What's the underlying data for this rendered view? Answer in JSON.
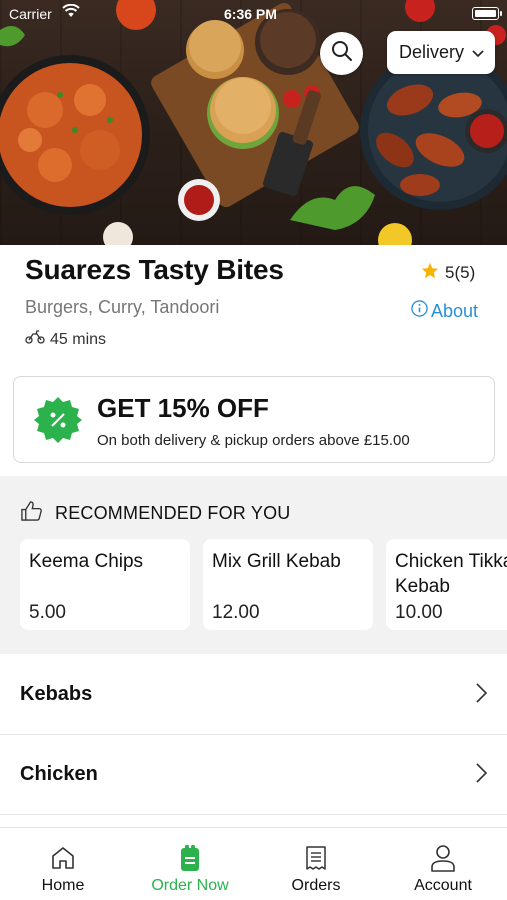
{
  "status_bar": {
    "carrier": "Carrier",
    "time": "6:36 PM"
  },
  "header": {
    "delivery_mode": "Delivery"
  },
  "restaurant": {
    "name": "Suarezs Tasty Bites",
    "rating": "5(5)",
    "cuisines": "Burgers, Curry, Tandoori",
    "about_label": "About",
    "delivery_time": "45 mins"
  },
  "offer": {
    "title": "GET 15% OFF",
    "subtitle": "On both delivery & pickup orders above £15.00"
  },
  "recommended": {
    "heading": "RECOMMENDED FOR YOU",
    "items": [
      {
        "name": "Keema Chips",
        "price": "5.00"
      },
      {
        "name": "Mix Grill Kebab",
        "price": "12.00"
      },
      {
        "name": "Chicken Tikka Kebab",
        "price": "10.00"
      }
    ]
  },
  "categories": [
    {
      "label": "Kebabs"
    },
    {
      "label": "Chicken"
    }
  ],
  "tabs": [
    {
      "label": "Home",
      "icon": "home-icon"
    },
    {
      "label": "Order Now",
      "icon": "order-bag-icon"
    },
    {
      "label": "Orders",
      "icon": "receipt-icon"
    },
    {
      "label": "Account",
      "icon": "user-icon"
    }
  ],
  "colors": {
    "accent": "#2bb24c",
    "link": "#2a8fd8",
    "star": "#f5b400"
  }
}
